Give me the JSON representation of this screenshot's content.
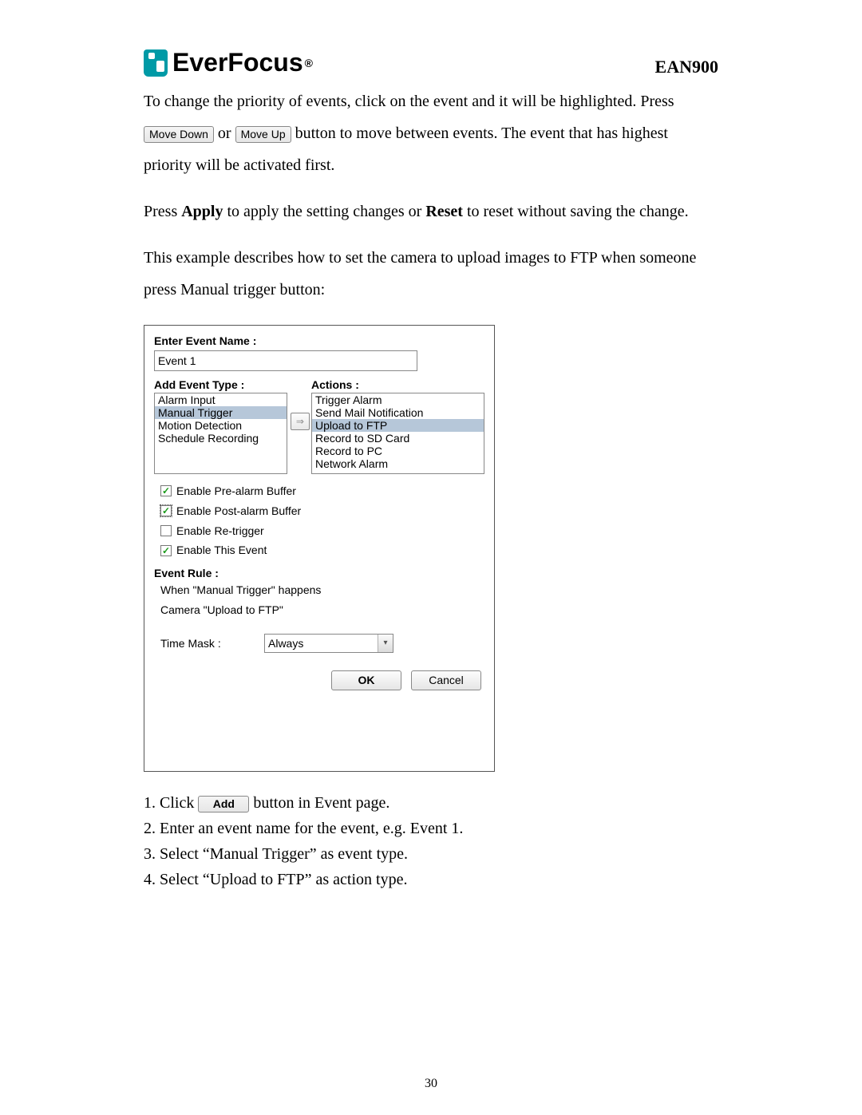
{
  "header": {
    "brand": "EverFocus",
    "product": "EAN900"
  },
  "body": {
    "p1a": "To change the priority of events, click on the event and it will be highlighted. Press",
    "btn_move_down": "Move Down",
    "or": " or ",
    "btn_move_up": "Move Up",
    "p1b": " button to move between events. The event that has highest priority will be activated first.",
    "p2a": "Press ",
    "apply": "Apply",
    "p2b": " to apply the setting changes or ",
    "reset": "Reset",
    "p2c": " to reset without saving the change.",
    "p3": "This example describes how to set the camera to upload images to FTP when someone press Manual trigger button:"
  },
  "dialog": {
    "enter_event_name_label": "Enter Event Name :",
    "event_name_value": "Event 1",
    "add_event_type_label": "Add Event Type :",
    "actions_label": "Actions :",
    "event_types": [
      "Alarm Input",
      "Manual Trigger",
      "Motion Detection",
      "Schedule Recording"
    ],
    "event_type_selected": "Manual Trigger",
    "actions": [
      "Trigger Alarm",
      "Send Mail Notification",
      "Upload to FTP",
      "Record to SD Card",
      "Record to PC",
      "Network Alarm"
    ],
    "action_selected": "Upload to FTP",
    "chk_pre": "Enable Pre-alarm Buffer",
    "chk_post": "Enable Post-alarm Buffer",
    "chk_retrig": "Enable Re-trigger",
    "chk_enable": "Enable This Event",
    "event_rule_label": "Event Rule :",
    "rule1": "When \"Manual Trigger\" happens",
    "rule2": "Camera \"Upload to FTP\"",
    "time_mask_label": "Time Mask :",
    "time_mask_value": "Always",
    "ok": "OK",
    "cancel": "Cancel"
  },
  "steps": {
    "s1a": "1. Click ",
    "btn_add": "Add",
    "s1b": " button in Event page.",
    "s2": "2. Enter an event name for the event, e.g. Event 1.",
    "s3": "3. Select “Manual Trigger” as event type.",
    "s4": "4. Select “Upload to FTP” as action type."
  },
  "page_number": "30"
}
